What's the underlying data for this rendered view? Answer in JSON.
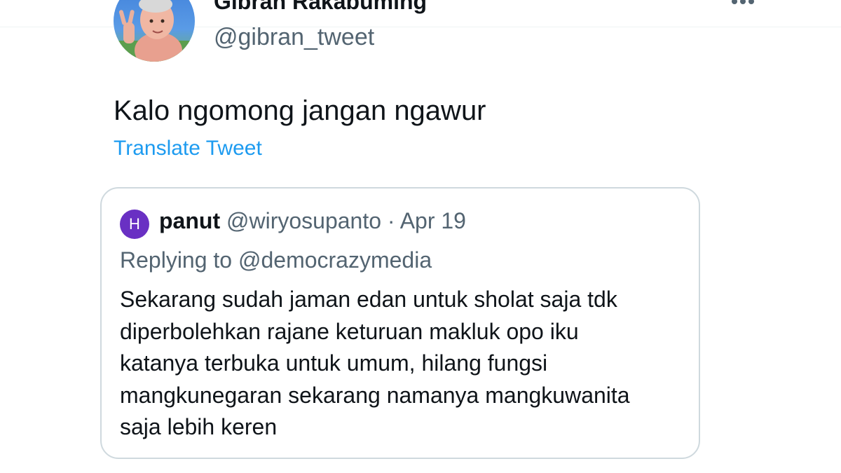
{
  "author": {
    "display_name": "Gibran Rakabuming",
    "handle": "@gibran_tweet",
    "avatar_icon": "profile-photo-peace-sign"
  },
  "more_icon": "more-options-icon",
  "tweet": {
    "text": "Kalo ngomong jangan ngawur",
    "translate_label": "Translate Tweet"
  },
  "quoted_tweet": {
    "avatar_initial": "H",
    "avatar_color": "#6930c3",
    "name": "panut",
    "handle": "@wiryosupanto",
    "separator": "·",
    "date": "Apr 19",
    "replying_to": "Replying to @democrazymedia",
    "body_lines": [
      "Sekarang sudah jaman edan untuk sholat saja tdk",
      "diperbolehkan rajane keturuan makluk opo iku",
      "katanya terbuka untuk umum, hilang fungsi",
      "mangkunegaran sekarang namanya mangkuwanita",
      "saja lebih keren"
    ]
  },
  "colors": {
    "text_primary": "#0f1419",
    "text_secondary": "#536471",
    "link": "#1d9bf0",
    "border": "#cfd9de"
  }
}
